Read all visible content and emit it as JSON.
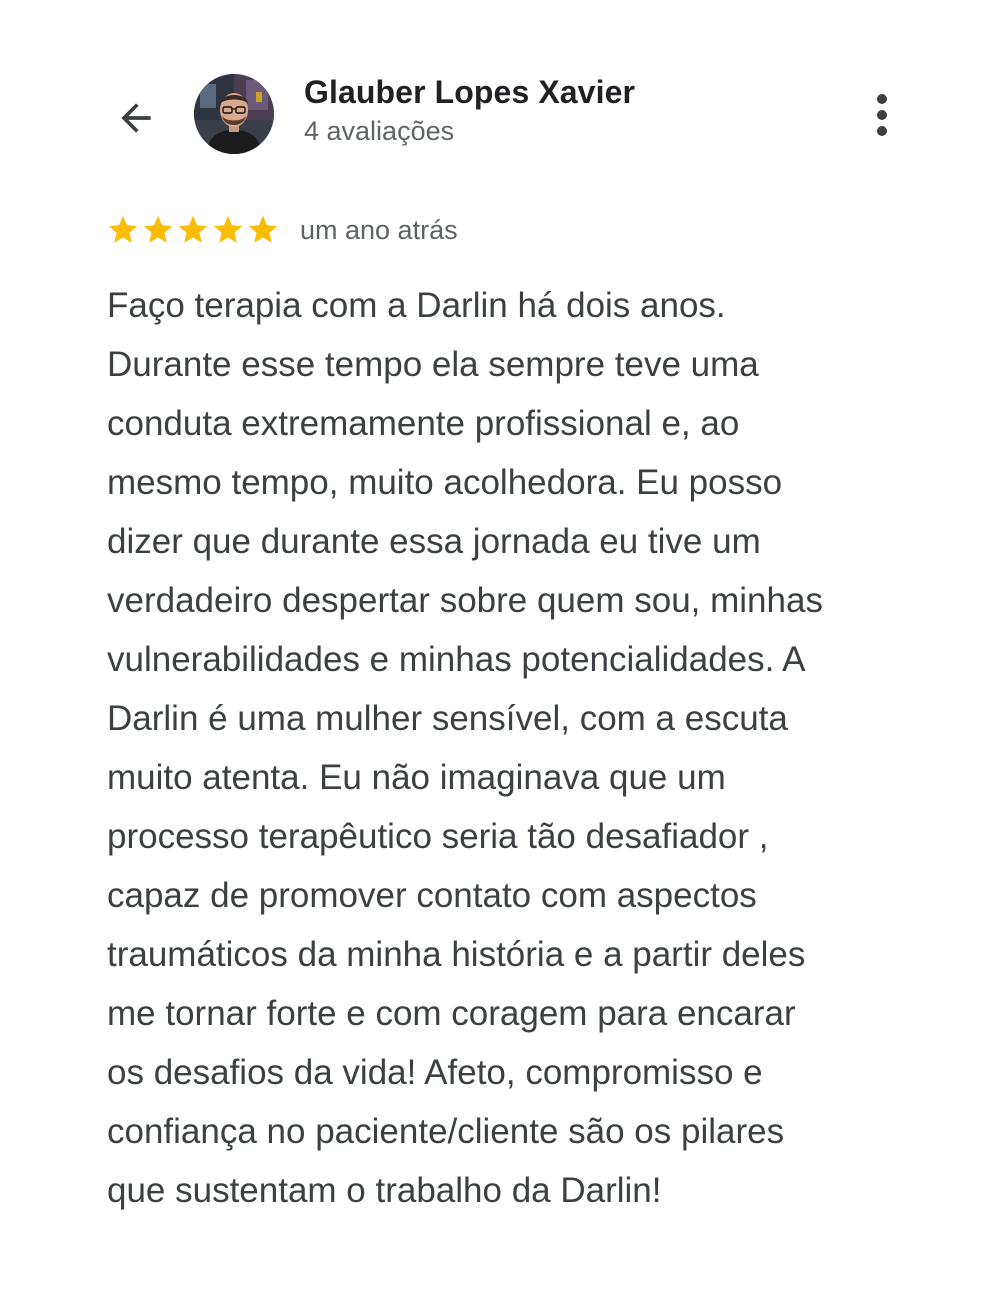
{
  "header": {
    "back_icon": "arrow-back-icon",
    "reviewer_name": "Glauber Lopes Xavier",
    "review_count": "4 avaliações",
    "avatar_icon": "avatar-photo",
    "more_icon": "more-vert-icon"
  },
  "review": {
    "rating": 5,
    "rating_max": 5,
    "star_color": "#FBBC04",
    "time_ago": "um ano atrás",
    "lines": [
      "Faço terapia com a Darlin há dois anos.",
      "Durante esse tempo ela sempre teve uma",
      "conduta extremamente profissional e, ao",
      "mesmo tempo, muito acolhedora. Eu posso",
      "dizer que durante essa jornada eu tive um",
      "verdadeiro despertar sobre quem sou, minhas",
      "vulnerabilidades e minhas potencialidades. A",
      "Darlin é uma mulher sensível, com a escuta",
      "muito atenta. Eu não imaginava que um",
      "processo terapêutico seria tão desafiador ,",
      "capaz de promover contato com aspectos",
      "traumáticos da minha história e a partir deles",
      "me tornar forte e com coragem para encarar",
      "os desafios da vida! Afeto, compromisso e",
      "confiança no paciente/cliente são os pilares",
      "que sustentam o trabalho da Darlin!"
    ]
  }
}
